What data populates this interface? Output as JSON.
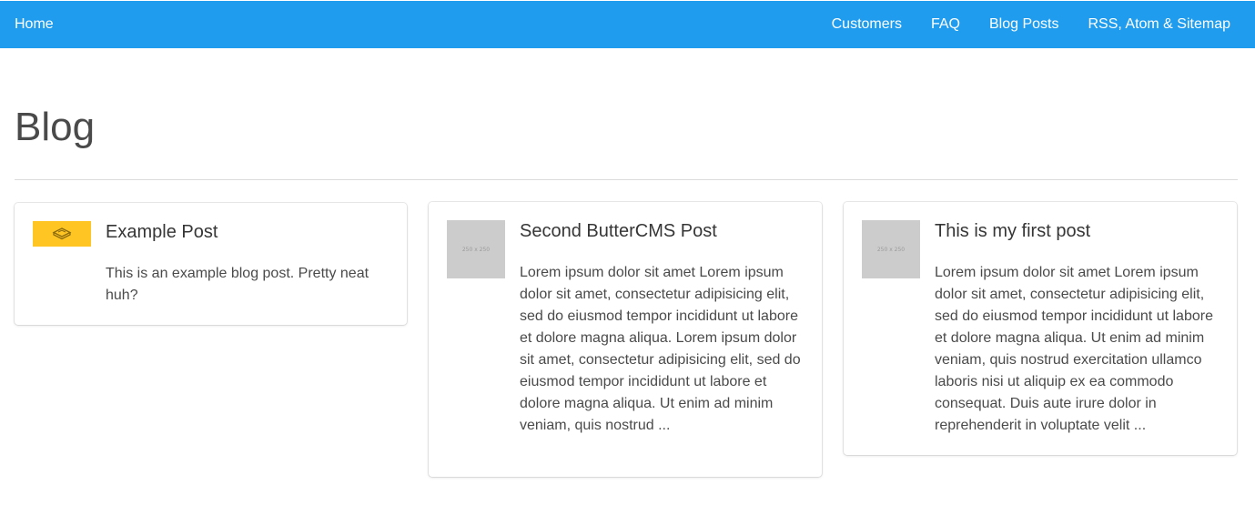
{
  "nav": {
    "home": "Home",
    "links": [
      "Customers",
      "FAQ",
      "Blog Posts",
      "RSS, Atom & Sitemap"
    ]
  },
  "page": {
    "title": "Blog"
  },
  "posts": [
    {
      "title": "Example Post",
      "summary": "This is an example blog post. Pretty neat huh?",
      "thumbnail": "butter-logo-icon"
    },
    {
      "title": "Second ButterCMS Post",
      "summary": "Lorem ipsum dolor sit amet Lorem ipsum dolor sit amet, consectetur adipisicing elit, sed do eiusmod tempor incididunt ut labore et dolore magna aliqua. Lorem ipsum dolor sit amet, consectetur adipisicing elit, sed do eiusmod tempor incididunt ut labore et dolore magna aliqua. Ut enim ad minim veniam, quis nostrud ...",
      "thumbnail_label": "250 x 250"
    },
    {
      "title": "This is my first post",
      "summary": "Lorem ipsum dolor sit amet Lorem ipsum dolor sit amet, consectetur adipisicing elit, sed do eiusmod tempor incididunt ut labore et dolore magna aliqua. Ut enim ad minim veniam, quis nostrud exercitation ullamco laboris nisi ut aliquip ex ea commodo consequat. Duis aute irure dolor in reprehenderit in voluptate velit ...",
      "thumbnail_label": "250 x 250"
    }
  ],
  "colors": {
    "navbar": "#209cee",
    "thumb_yellow": "#ffc523",
    "placeholder_gray": "#cccccc"
  }
}
